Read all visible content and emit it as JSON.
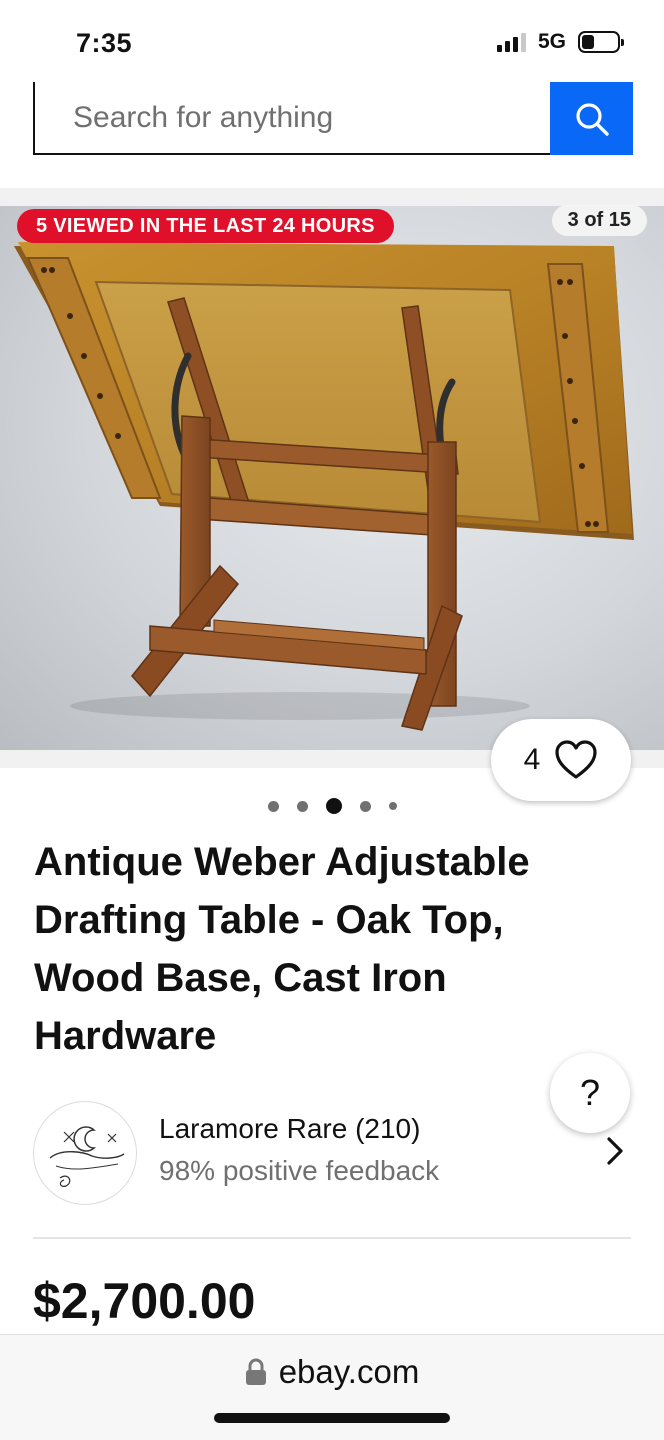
{
  "status_bar": {
    "time": "7:35",
    "network": "5G"
  },
  "search": {
    "placeholder": "Search for anything"
  },
  "photo": {
    "viewed_badge": "5 VIEWED IN THE LAST 24 HOURS",
    "counter": "3 of 15",
    "watch_count": "4",
    "carousel_dots": 5,
    "active_dot_index": 2
  },
  "listing": {
    "title": "Antique Weber Adjustable Drafting Table - Oak Top, Wood Base, Cast Iron Hardware",
    "price": "$2,700.00"
  },
  "seller": {
    "name": "Laramore Rare (210)",
    "feedback": "98% positive feedback"
  },
  "help": {
    "label": "?"
  },
  "browser": {
    "url": "ebay.com"
  },
  "colors": {
    "accent": "#0968f6",
    "badge_red": "#e0102a"
  },
  "icons": [
    "signal-icon",
    "battery-icon",
    "search-icon",
    "heart-icon",
    "question-icon",
    "chevron-right-icon",
    "lock-icon"
  ]
}
